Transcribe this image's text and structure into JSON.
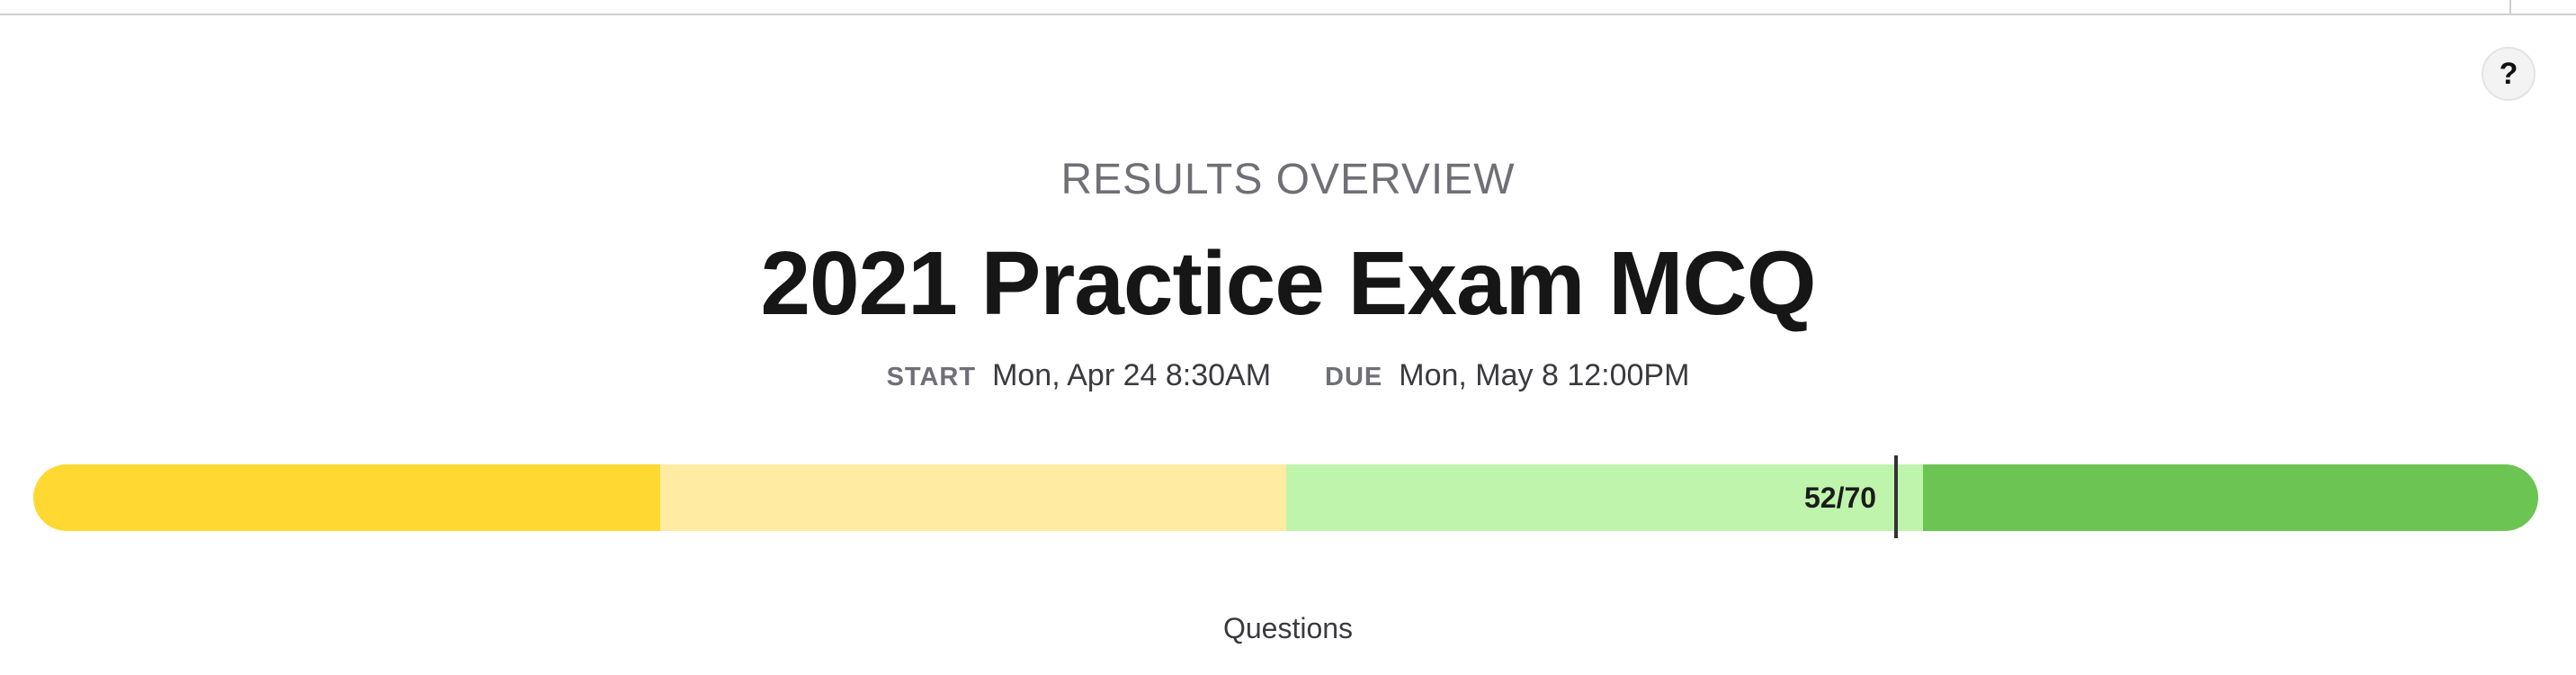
{
  "help": {
    "label": "?"
  },
  "header": {
    "overview_label": "RESULTS OVERVIEW",
    "title": "2021 Practice Exam MCQ"
  },
  "dates": {
    "start_label": "START",
    "start_value": "Mon, Apr 24 8:30AM",
    "due_label": "DUE",
    "due_value": "Mon, May 8 12:00PM"
  },
  "score": {
    "text": "52/70",
    "earned": 52,
    "total": 70,
    "band_colors": [
      "#ffd932",
      "#ffeba1",
      "#bff4ad",
      "#6cc453"
    ]
  },
  "footer": {
    "questions_label": "Questions"
  }
}
